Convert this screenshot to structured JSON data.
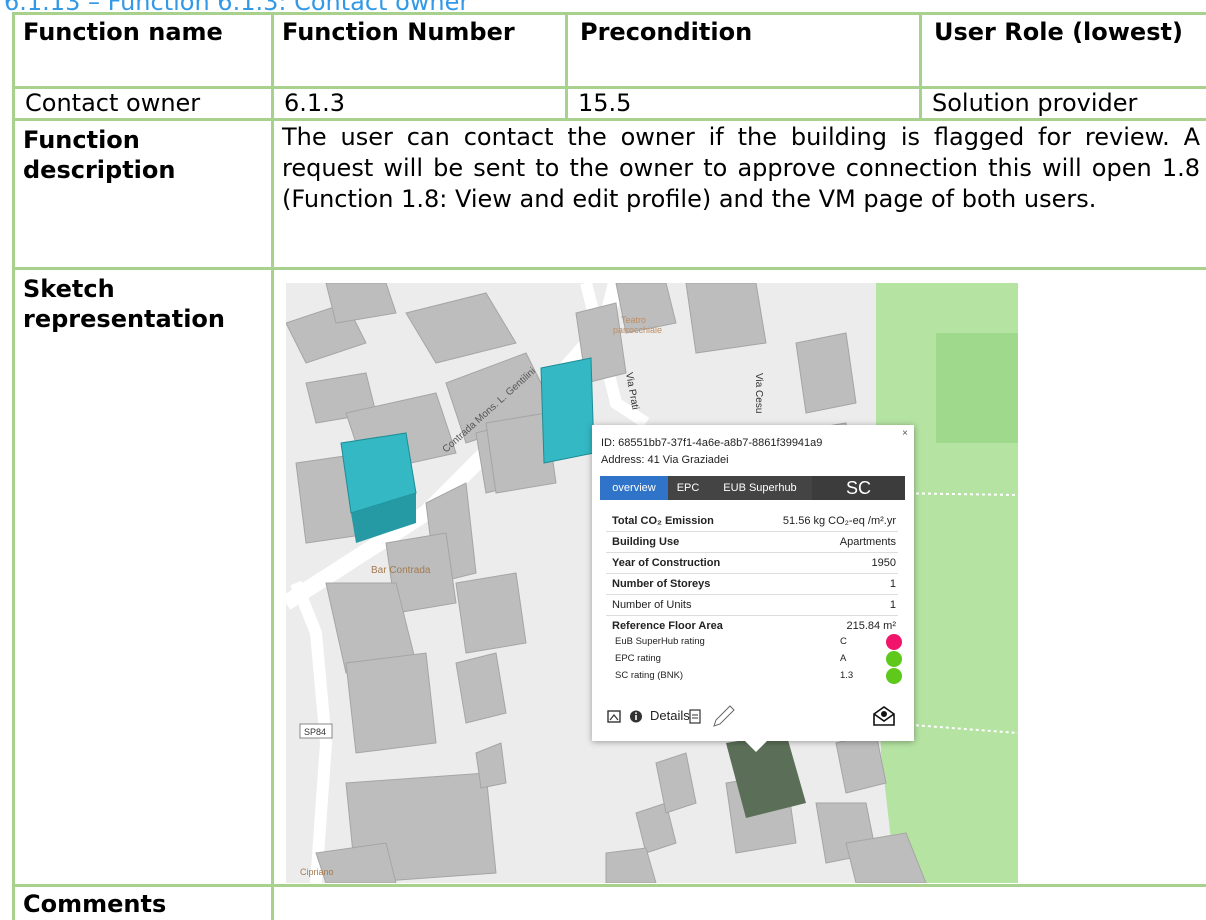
{
  "caption": "6.1.13 – Function 6.1.3: Contact owner",
  "headers": {
    "function_name": "Function name",
    "function_number": "Function Number",
    "precondition": "Precondition",
    "user_role": "User Role (lowest)"
  },
  "row_values": {
    "function_name": "Contact owner",
    "function_number": "6.1.3",
    "precondition": "15.5",
    "user_role": "Solution provider"
  },
  "description": {
    "label": "Function description",
    "text": "The user can contact the owner if the building is flagged for review. A request will be sent to the owner to approve connection this will open 1.8 (Function 1.8: View and edit profile) and the VM page of both users."
  },
  "sketch": {
    "label": "Sketch representation"
  },
  "comments": {
    "label": "Comments",
    "value": ""
  },
  "map": {
    "street_labels": [
      "Contrada Mons. L. Gentilini",
      "Via Prati",
      "Via Cesu",
      "Teatro parrocchiale",
      "Bar Contrada",
      "SP84",
      "Cipriano"
    ],
    "building_highlight_color": "#33b8c4"
  },
  "popup": {
    "close": "×",
    "id_line": "ID: 68551bb7-37f1-4a6e-a8b7-8861f39941a9",
    "address_line": "Address: 41  Via Graziadei",
    "tabs": [
      "overview",
      "EPC",
      "EUB Superhub",
      "SC"
    ],
    "rows": [
      {
        "label": "Total CO₂ Emission",
        "value": "51.56 kg CO₂-eq /m².yr"
      },
      {
        "label": "Building Use",
        "value": "Apartments"
      },
      {
        "label": "Year of Construction",
        "value": "1950"
      },
      {
        "label": "Number of Storeys",
        "value": "1"
      },
      {
        "label": "Number of Units",
        "value": "1"
      },
      {
        "label": "Reference Floor Area",
        "value": "215.84 m²"
      }
    ],
    "ratings": [
      {
        "label": "EuB SuperHub rating",
        "value": "C",
        "color": "#f0156a"
      },
      {
        "label": "EPC rating",
        "value": "A",
        "color": "#5ec91b"
      },
      {
        "label": "SC rating (BNK)",
        "value": "1.3",
        "color": "#5ec91b"
      }
    ],
    "footer": {
      "details": "Details"
    }
  }
}
